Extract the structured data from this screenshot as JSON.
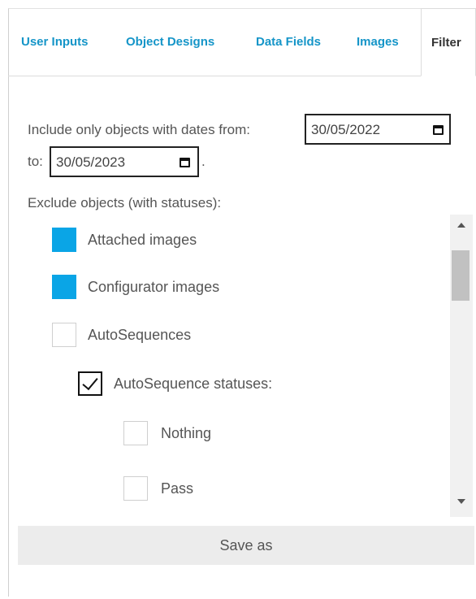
{
  "tabs": [
    {
      "label": "User Inputs",
      "active": false
    },
    {
      "label": "Object Designs",
      "active": false
    },
    {
      "label": "Data Fields",
      "active": false
    },
    {
      "label": "Images",
      "active": false
    },
    {
      "label": "Filter",
      "active": true
    }
  ],
  "date_filter": {
    "prefix": "Include only objects with dates from:",
    "from_value": "30/05/2022",
    "to_label": "to:",
    "to_value": "30/05/2023",
    "suffix": "."
  },
  "exclude": {
    "heading": "Exclude objects (with statuses):",
    "items": [
      {
        "label": "Attached images",
        "state": "filled"
      },
      {
        "label": "Configurator images",
        "state": "filled"
      },
      {
        "label": "AutoSequences",
        "state": "unchecked"
      },
      {
        "label": "AutoSequence statuses:",
        "state": "checked"
      },
      {
        "label": "Nothing",
        "state": "unchecked"
      },
      {
        "label": "Pass",
        "state": "unchecked"
      }
    ]
  },
  "save_button": {
    "label": "Save as"
  },
  "colors": {
    "tab_link": "#1595c8",
    "checkbox_fill": "#0aa5e6",
    "button_bg": "#ececec"
  },
  "icons": {
    "date_picker": "calendar-icon",
    "scroll_up": "scroll-up-arrow-icon",
    "scroll_down": "scroll-down-arrow-icon"
  }
}
